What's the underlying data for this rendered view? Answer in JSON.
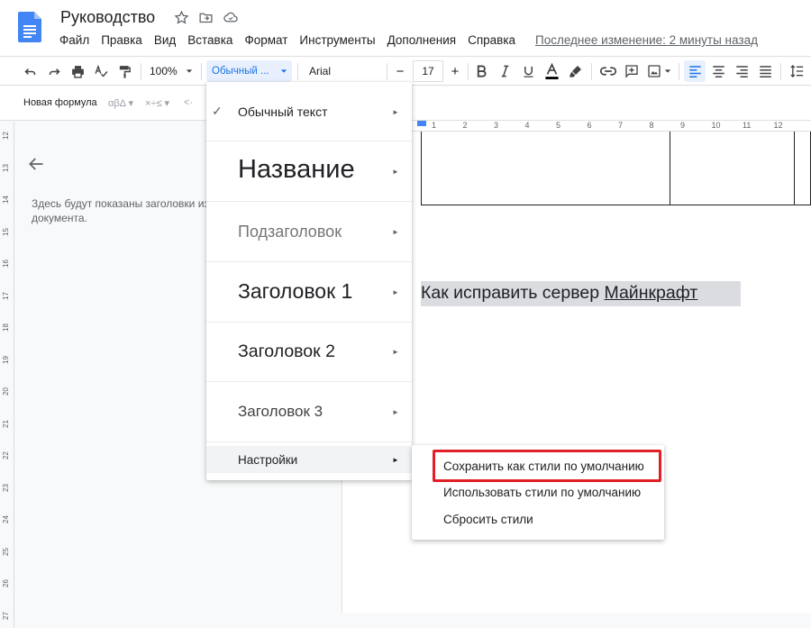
{
  "app": {
    "title": "Руководство",
    "last_edit": "Последнее изменение: 2 минуты назад"
  },
  "menu": [
    "Файл",
    "Правка",
    "Вид",
    "Вставка",
    "Формат",
    "Инструменты",
    "Дополнения",
    "Справка"
  ],
  "toolbar": {
    "zoom": "100%",
    "style_value": "Обычный ...",
    "font": "Arial",
    "font_size": "17",
    "minus": "−",
    "plus": "+"
  },
  "equation_bar": {
    "new_formula": "Новая формула",
    "groups": [
      "αβΔ ▾",
      "×÷≤ ▾",
      "<·"
    ]
  },
  "outline": {
    "text": "Здесь будут показаны заголовки из документа."
  },
  "ruler": {
    "horizontal": [
      "1",
      "2",
      "3",
      "4",
      "5",
      "6",
      "7",
      "8",
      "9",
      "10",
      "11",
      "12"
    ],
    "vertical": [
      "12",
      "13",
      "14",
      "15",
      "16",
      "17",
      "18",
      "19",
      "20",
      "21",
      "22",
      "23",
      "24",
      "25",
      "26",
      "27"
    ]
  },
  "document": {
    "heading_plain": "Как исправить сервер ",
    "heading_link": "Майнкрафт"
  },
  "style_menu": {
    "items": [
      {
        "label": "Обычный текст",
        "checked": true
      },
      {
        "label": "Название"
      },
      {
        "label": "Подзаголовок"
      },
      {
        "label": "Заголовок 1"
      },
      {
        "label": "Заголовок 2"
      },
      {
        "label": "Заголовок 3"
      },
      {
        "label": "Настройки"
      }
    ],
    "arrow": "►",
    "check": "✓"
  },
  "settings_submenu": {
    "items": [
      "Сохранить как стили по умолчанию",
      "Использовать стили по умолчанию",
      "Сбросить стили"
    ],
    "highlighted_index": 0,
    "highlight_color": "#e01f26"
  },
  "colors": {
    "accent": "#1a73e8",
    "docs_blue": "#4285f4"
  }
}
